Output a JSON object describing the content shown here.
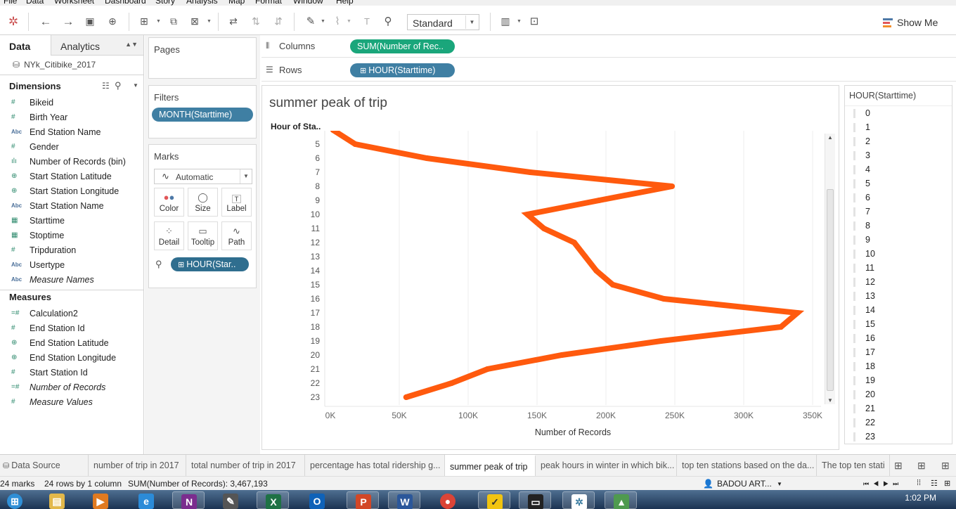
{
  "menu": [
    "File",
    "Data",
    "Worksheet",
    "Dashboard",
    "Story",
    "Analysis",
    "Map",
    "Format",
    "Window",
    "Help"
  ],
  "toolbar": {
    "fit_mode": "Standard",
    "show_me": "Show Me"
  },
  "data_pane": {
    "tab_data": "Data",
    "tab_analytics": "Analytics",
    "datasource": "NYk_Citibike_2017",
    "dimensions_title": "Dimensions",
    "dimensions": [
      {
        "label": "Bikeid",
        "type": "number"
      },
      {
        "label": "Birth Year",
        "type": "number"
      },
      {
        "label": "End Station Name",
        "type": "string"
      },
      {
        "label": "Gender",
        "type": "number"
      },
      {
        "label": "Number of Records (bin)",
        "type": "bin"
      },
      {
        "label": "Start Station Latitude",
        "type": "geo"
      },
      {
        "label": "Start Station Longitude",
        "type": "geo"
      },
      {
        "label": "Start Station Name",
        "type": "string"
      },
      {
        "label": "Starttime",
        "type": "date"
      },
      {
        "label": "Stoptime",
        "type": "date"
      },
      {
        "label": "Tripduration",
        "type": "number"
      },
      {
        "label": "Usertype",
        "type": "string"
      },
      {
        "label": "Measure Names",
        "type": "string",
        "italic": true
      }
    ],
    "measures_title": "Measures",
    "measures": [
      {
        "label": "Calculation2",
        "type": "calc"
      },
      {
        "label": "End Station Id",
        "type": "number"
      },
      {
        "label": "End Station Latitude",
        "type": "geo"
      },
      {
        "label": "End Station Longitude",
        "type": "geo"
      },
      {
        "label": "Start Station Id",
        "type": "number"
      },
      {
        "label": "Number of Records",
        "type": "calc",
        "italic": true
      },
      {
        "label": "Measure Values",
        "type": "number",
        "italic": true
      }
    ]
  },
  "cards": {
    "pages_title": "Pages",
    "filters_title": "Filters",
    "filter_pill": "MONTH(Starttime)",
    "marks_title": "Marks",
    "mark_type": "Automatic",
    "mark_buttons": [
      "Color",
      "Size",
      "Label",
      "Detail",
      "Tooltip",
      "Path"
    ],
    "path_pill": "HOUR(Star.."
  },
  "shelves": {
    "columns_label": "Columns",
    "columns_pill": "SUM(Number of Rec..",
    "rows_label": "Rows",
    "rows_pill": "HOUR(Starttime)"
  },
  "sheet_title": "summer peak of trip",
  "row_header": "Hour of Sta..",
  "legend": {
    "title": "HOUR(Starttime)",
    "items": [
      "0",
      "1",
      "2",
      "3",
      "4",
      "5",
      "6",
      "7",
      "8",
      "9",
      "10",
      "11",
      "12",
      "13",
      "14",
      "15",
      "16",
      "17",
      "18",
      "19",
      "20",
      "21",
      "22",
      "23"
    ]
  },
  "chart_data": {
    "type": "line",
    "title": "summer peak of trip",
    "xlabel": "Number of Records",
    "ylabel": "Hour of Sta..",
    "xlim": [
      0,
      360000
    ],
    "x_ticks": [
      "0K",
      "50K",
      "100K",
      "150K",
      "200K",
      "250K",
      "300K",
      "350K"
    ],
    "y_categories": [
      "5",
      "6",
      "7",
      "8",
      "9",
      "10",
      "11",
      "12",
      "13",
      "14",
      "15",
      "16",
      "17",
      "18",
      "19",
      "20",
      "21",
      "22",
      "23"
    ],
    "series": [
      {
        "color": "#ff5a0e",
        "points": [
          {
            "hour": 4,
            "value": 2000
          },
          {
            "hour": 5,
            "value": 18000
          },
          {
            "hour": 6,
            "value": 70000
          },
          {
            "hour": 7,
            "value": 145000
          },
          {
            "hour": 8,
            "value": 248000
          },
          {
            "hour": 9,
            "value": 195000
          },
          {
            "hour": 10,
            "value": 143000
          },
          {
            "hour": 11,
            "value": 155000
          },
          {
            "hour": 12,
            "value": 177000
          },
          {
            "hour": 13,
            "value": 185000
          },
          {
            "hour": 14,
            "value": 193000
          },
          {
            "hour": 15,
            "value": 205000
          },
          {
            "hour": 16,
            "value": 242000
          },
          {
            "hour": 17,
            "value": 339000
          },
          {
            "hour": 18,
            "value": 327000
          },
          {
            "hour": 19,
            "value": 240000
          },
          {
            "hour": 20,
            "value": 168000
          },
          {
            "hour": 21,
            "value": 114000
          },
          {
            "hour": 22,
            "value": 88000
          },
          {
            "hour": 23,
            "value": 55000
          }
        ]
      }
    ],
    "grid": true
  },
  "sheet_tabs": {
    "datasource_tab": "Data Source",
    "tabs": [
      "number of trip in 2017",
      "total number of trip in 2017",
      "percentage has total ridership g...",
      "summer peak of trip",
      "peak hours in winter in which bik...",
      "top ten stations based on the da...",
      "The top ten  stati"
    ],
    "active_index": 3
  },
  "status": {
    "marks": "24 marks",
    "dims": "24 rows by 1 column",
    "sum": "SUM(Number of Records): 3,467,193",
    "user": "BADOU ART..."
  },
  "taskbar": {
    "time": "1:02 PM"
  }
}
